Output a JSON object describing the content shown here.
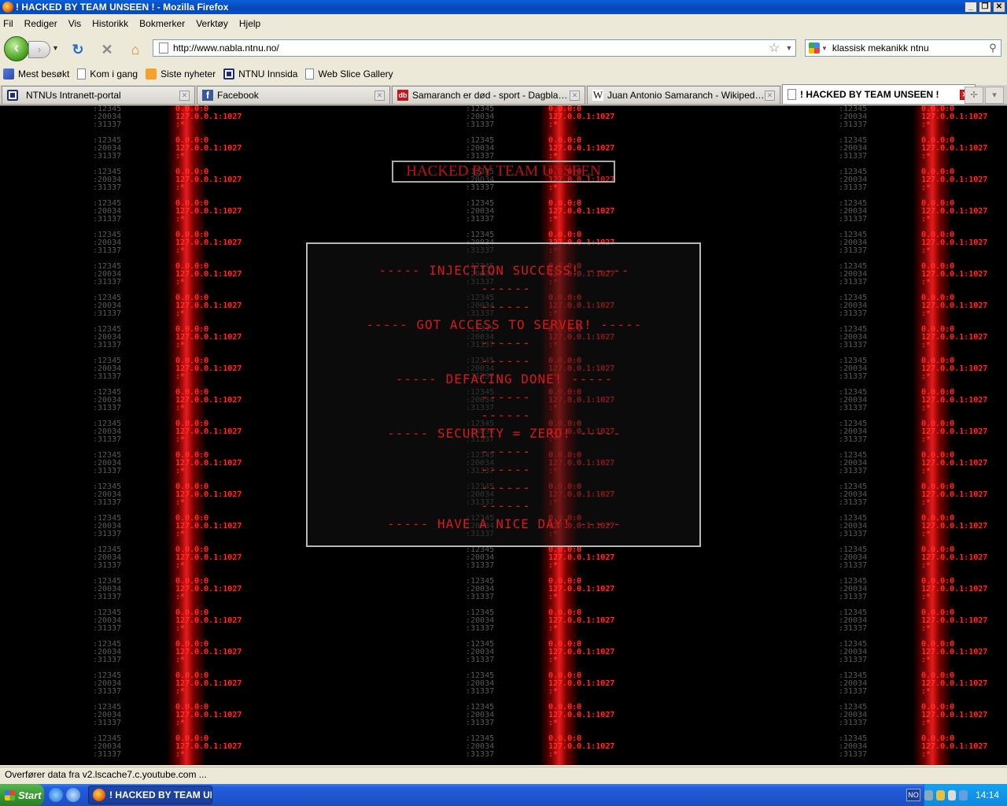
{
  "window": {
    "title": "! HACKED BY TEAM UNSEEN ! - Mozilla Firefox",
    "minimize": "_",
    "maximize": "❐",
    "close": "✕"
  },
  "menu": [
    "Fil",
    "Rediger",
    "Vis",
    "Historikk",
    "Bokmerker",
    "Verktøy",
    "Hjelp"
  ],
  "nav": {
    "url": "http://www.nabla.ntnu.no/",
    "search_value": "klassisk mekanikk ntnu"
  },
  "bookmarks": [
    "Mest besøkt",
    "Kom i gang",
    "Siste nyheter",
    "NTNU Innsida",
    "Web Slice Gallery"
  ],
  "tabs": [
    {
      "label": "NTNUs Intranett-portal",
      "icon": "ntnu-icon"
    },
    {
      "label": "Facebook",
      "icon": "facebook-icon",
      "glyph": "f"
    },
    {
      "label": "Samaranch er død - sport - Dagbladet...",
      "icon": "dagbladet-icon",
      "glyph": "db"
    },
    {
      "label": "Juan Antonio Samaranch - Wikipedia, ...",
      "icon": "wikipedia-icon",
      "glyph": "W"
    },
    {
      "label": "! HACKED BY TEAM UNSEEN !",
      "icon": "page-icon"
    }
  ],
  "page": {
    "banner": "HACKED BY TEAM UNSEEN",
    "col_gray": ":12345\n:20034\n:31337",
    "col_red": "0.0.0:0\n127.0.0.1:1027\n:*",
    "messages": [
      "----- INJECTION SUCCESS! -----",
      "----- GOT ACCESS TO SERVER! -----",
      "----- DEFACING DONE! -----",
      "----- SECURITY = ZERO! -----",
      "----- HAVE A NICE DAY! -----"
    ],
    "dash": "------"
  },
  "status": "Overfører data fra v2.lscache7.c.youtube.com ...",
  "taskbar": {
    "start": "Start",
    "task": "! HACKED BY TEAM UN...",
    "lang": "NO",
    "clock": "14:14"
  }
}
